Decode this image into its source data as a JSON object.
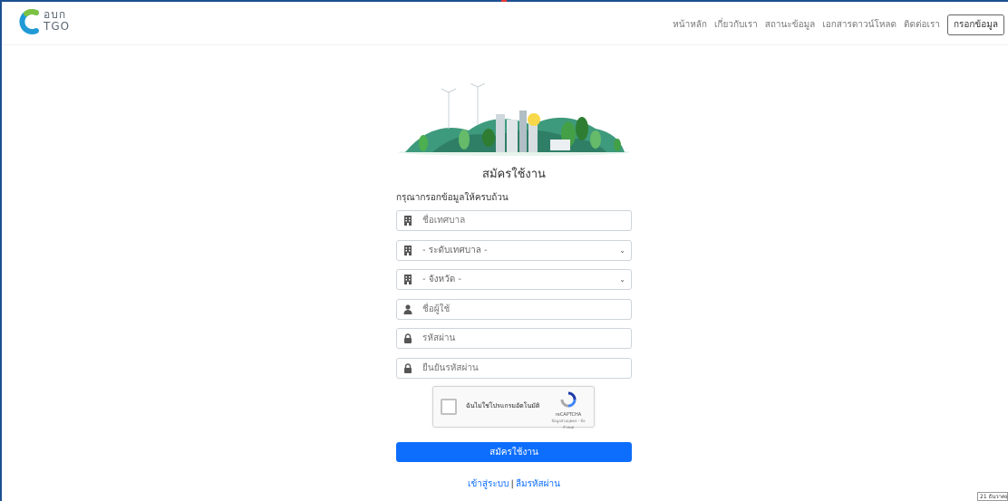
{
  "header": {
    "logo_text_line1": "อบก",
    "logo_text_line2": "TGO",
    "nav": [
      {
        "label": "หน้าหลัก"
      },
      {
        "label": "เกี่ยวกับเรา"
      },
      {
        "label": "สถานะข้อมูล"
      },
      {
        "label": "เอกสารดาวน์โหลด"
      },
      {
        "label": "ติดต่อเรา"
      }
    ],
    "cta_label": "กรอกข้อมูล"
  },
  "form": {
    "title": "สมัครใช้งาน",
    "subtitle": "กรุณากรอกข้อมูลให้ครบถ้วน",
    "fields": {
      "municipality_name": {
        "placeholder": "ชื่อเทศบาล",
        "icon": "building-icon"
      },
      "municipality_level": {
        "value": "- ระดับเทศบาล -",
        "icon": "building-icon"
      },
      "province": {
        "value": "- จังหวัด -",
        "icon": "building-icon"
      },
      "username": {
        "placeholder": "ชื่อผู้ใช้",
        "icon": "user-icon"
      },
      "password": {
        "placeholder": "รหัสผ่าน",
        "icon": "lock-icon"
      },
      "confirm_password": {
        "placeholder": "ยืนยันรหัสผ่าน",
        "icon": "lock-icon"
      }
    },
    "captcha": {
      "label": "ฉันไม่ใช่โปรแกรมอัตโนมัติ",
      "brand": "reCAPTCHA",
      "terms": "ข้อมูลส่วนบุคคล - ข้อกำหนด"
    },
    "submit_label": "สมัครใช้งาน",
    "login_link": "เข้าสู่ระบบ",
    "separator": "|",
    "forgot_link": "ลืมรหัสผ่าน"
  },
  "corner_badge": "21 ธันวาคม",
  "colors": {
    "primary": "#0d6efd",
    "frame": "#1d4f91",
    "logo_green": "#7cc242",
    "logo_blue": "#1f9ad6"
  }
}
